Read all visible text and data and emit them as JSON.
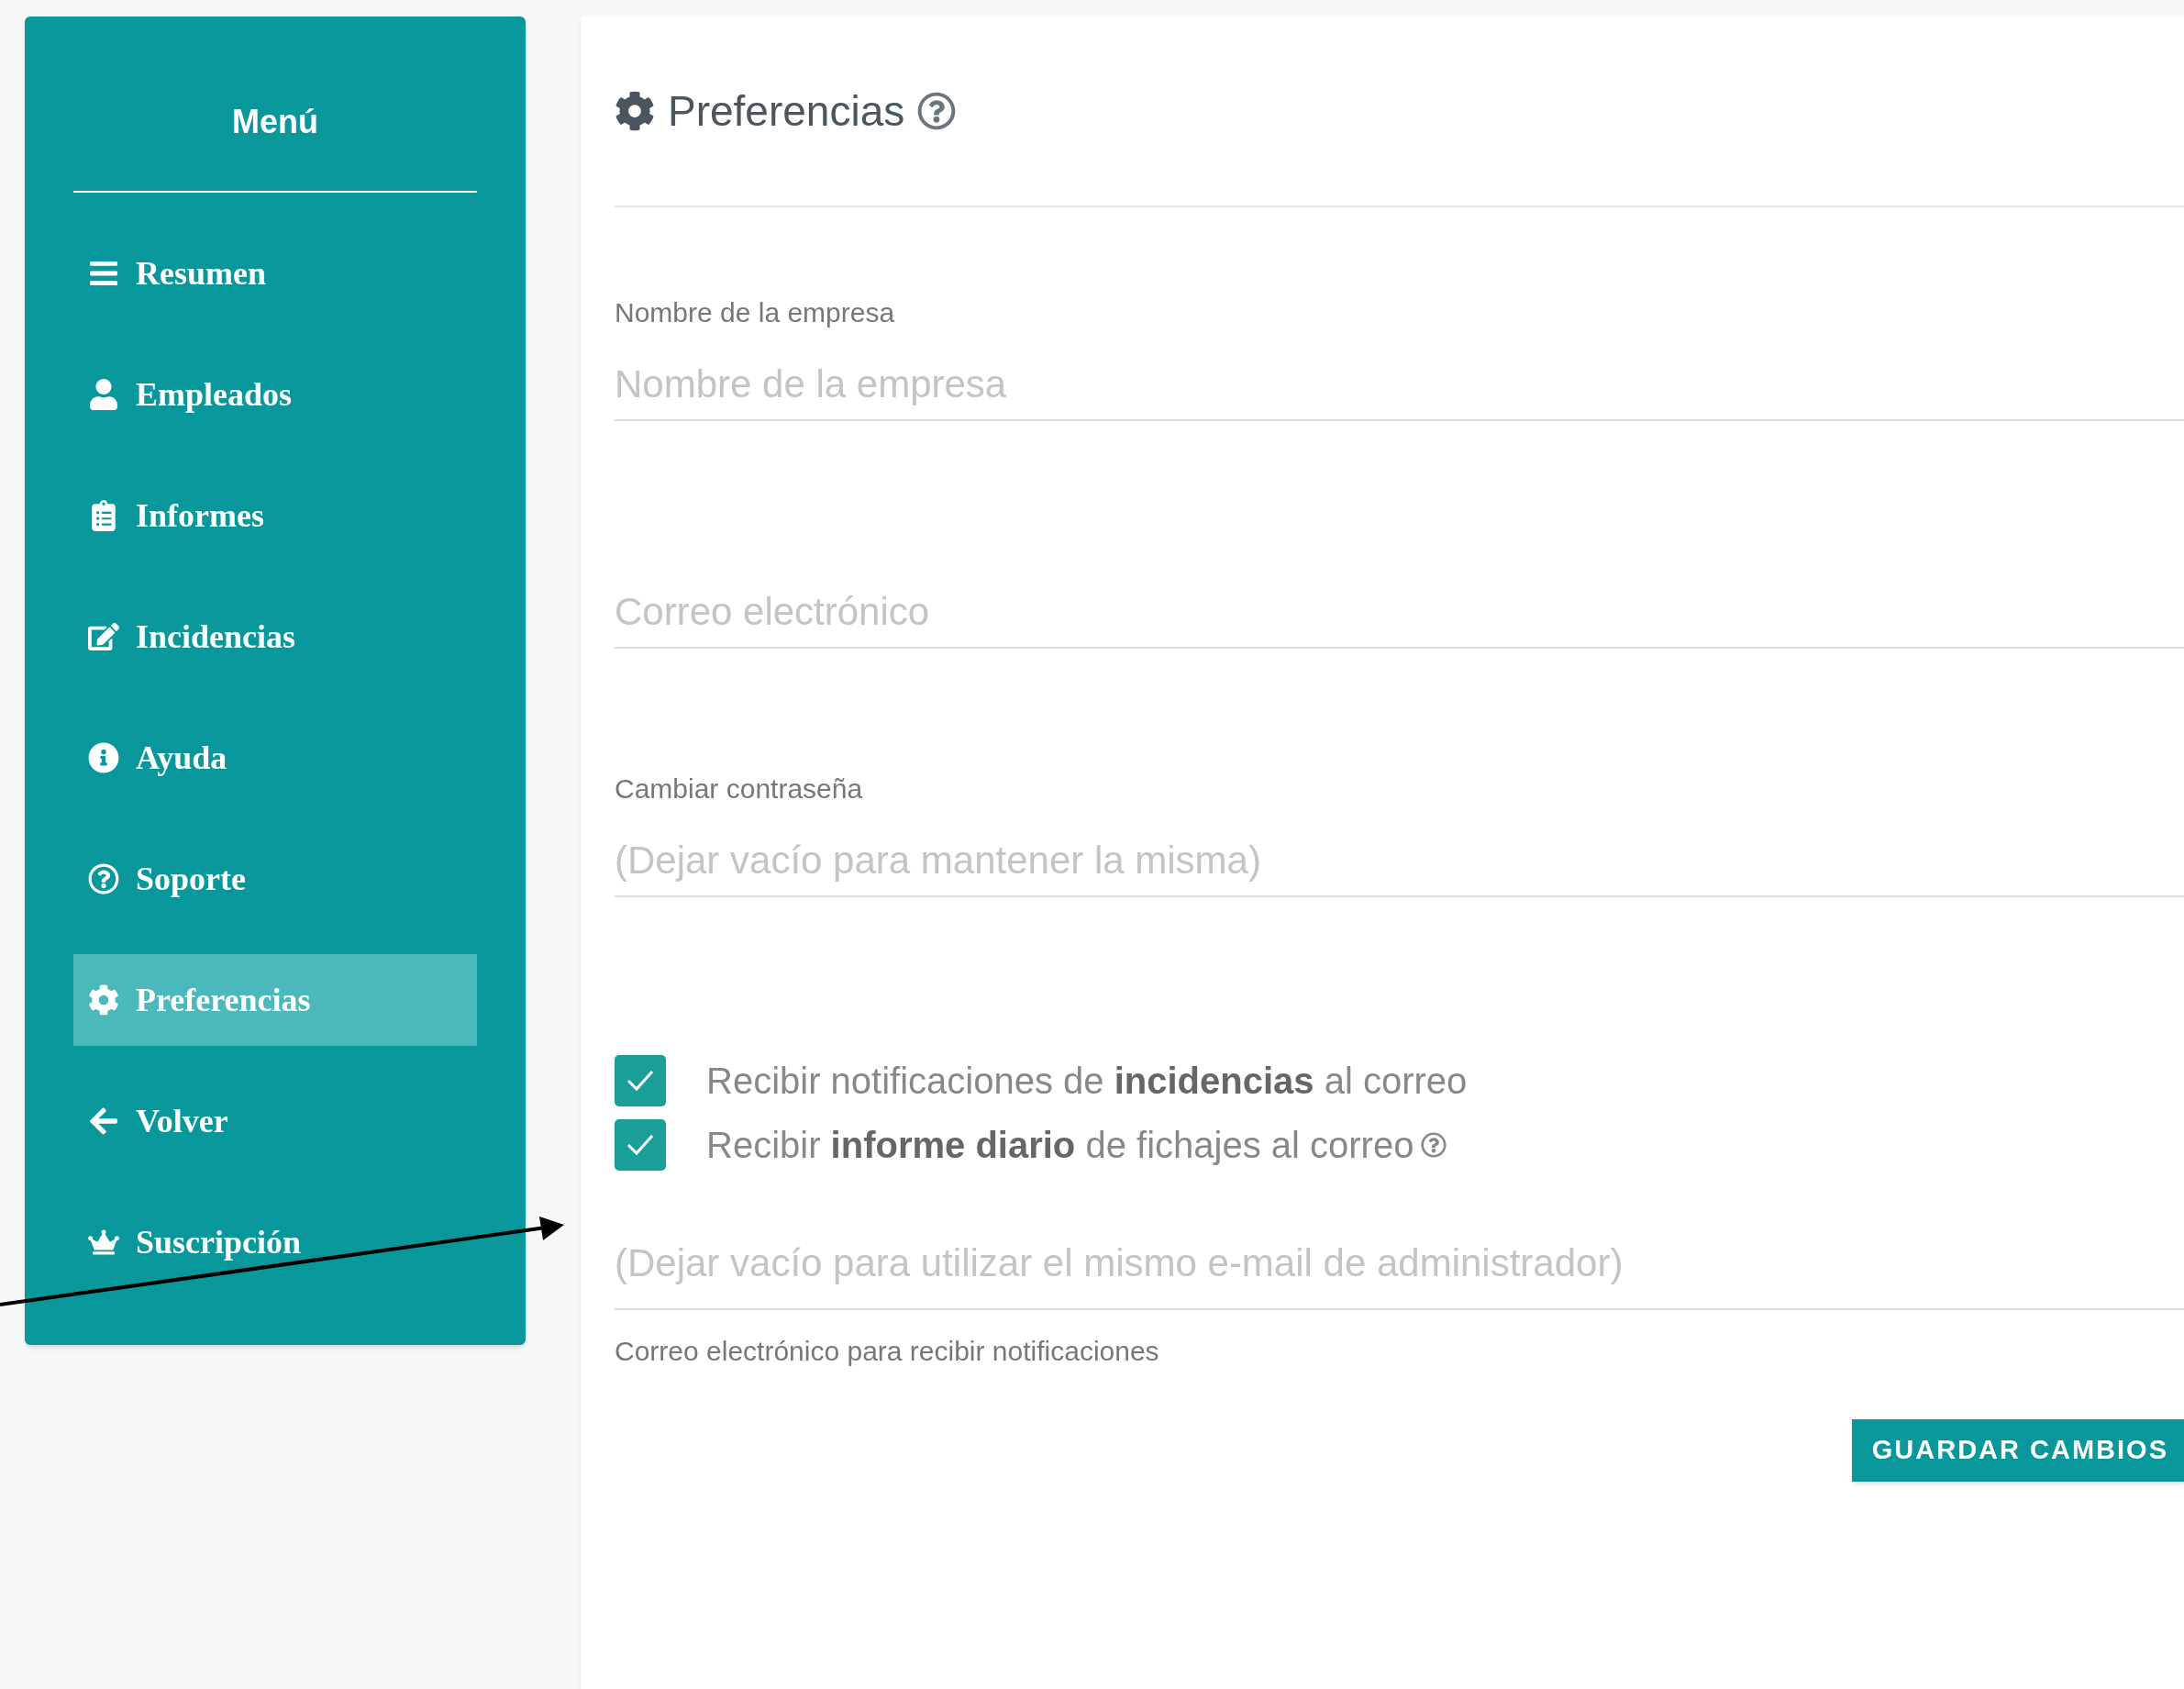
{
  "sidebar": {
    "title": "Menú",
    "items": [
      {
        "label": "Resumen",
        "selected": false
      },
      {
        "label": "Empleados",
        "selected": false
      },
      {
        "label": "Informes",
        "selected": false
      },
      {
        "label": "Incidencias",
        "selected": false
      },
      {
        "label": "Ayuda",
        "selected": false
      },
      {
        "label": "Soporte",
        "selected": false
      },
      {
        "label": "Preferencias",
        "selected": true
      },
      {
        "label": "Volver",
        "selected": false
      },
      {
        "label": "Suscripción",
        "selected": false
      }
    ]
  },
  "panel": {
    "title": "Preferencias",
    "fields": [
      {
        "label": "Nombre de la empresa",
        "placeholder": "Nombre de la empresa"
      },
      {
        "placeholder": "Correo electrónico"
      },
      {
        "label": "Cambiar contraseña",
        "placeholder": "(Dejar vacío para mantener la misma)"
      }
    ],
    "checkboxes": [
      {
        "text": "Recibir notificaciones de **incidencias** al correo",
        "checked": true,
        "help_icon": false
      },
      {
        "text": "Recibir **informe diario** de fichajes al correo",
        "checked": true,
        "help_icon": true
      }
    ],
    "notification_email": {
      "placeholder": "(Dejar vacío para utilizar el mismo e-mail de administrador)",
      "helper": "Correo electrónico para recibir notificaciones"
    },
    "save_button": "GUARDAR CAMBIOS"
  }
}
